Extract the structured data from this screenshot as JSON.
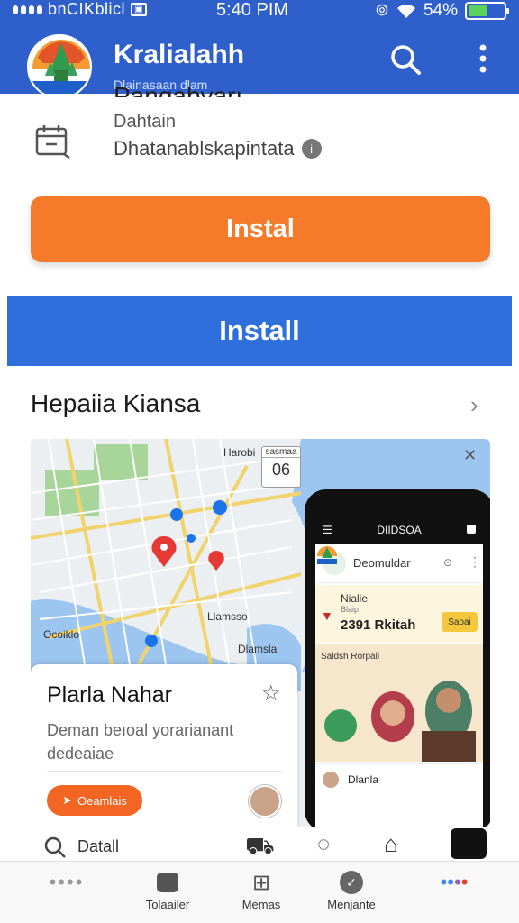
{
  "status_bar": {
    "carrier": "bnCIKblicl",
    "time": "5:40 PIM",
    "battery_text": "54%",
    "battery_level": 0.54
  },
  "app_bar": {
    "title": "Kralialahh",
    "subtitle": "Dlainasaan dlam"
  },
  "listing": {
    "clipped_title": "Pangabyarı",
    "developer_label": "Dahtain",
    "developer_name": "Dhatanablskapintata"
  },
  "buttons": {
    "install_primary": "Instal",
    "install_secondary": "Install"
  },
  "section": {
    "title": "Hepaiia Kiansa"
  },
  "map": {
    "top_label": "Harobi",
    "time_box_top": "sasmaa",
    "time_box_value": "06",
    "label_district": "Llamsso",
    "label_bottom_left": "Ocoiklo",
    "label_bottom": "Dlamsla"
  },
  "place_card": {
    "name": "Plarla Nahar",
    "description": "Deman beıoal yorarianant dedeaiae",
    "route_button": "Oeamlais"
  },
  "phone_mock": {
    "header": "DIIDSOA",
    "app_title": "Deomuldar",
    "promo_name": "Nialie",
    "promo_sub": "Blaip",
    "promo_price": "2391 Rkitah",
    "promo_button": "Saoai",
    "section_title": "Saldsh Rorpali",
    "row_name": "Dlanla"
  },
  "search_strip": {
    "text": "Datall"
  },
  "bottom_nav": {
    "items": [
      {
        "label": ""
      },
      {
        "label": "Tolaailer"
      },
      {
        "label": "Memas"
      },
      {
        "label": "Menjante"
      },
      {
        "label": ""
      }
    ]
  },
  "colors": {
    "primary_blue": "#2f5fcb",
    "install_blue": "#2f6fdc",
    "install_orange": "#f57b2a",
    "route_orange": "#f26522"
  },
  "icons": {
    "app_bar": [
      "search-icon",
      "more-vert-icon"
    ],
    "developer": "calendar-icon",
    "info": "info-icon",
    "chevron": "chevron-right-icon"
  }
}
